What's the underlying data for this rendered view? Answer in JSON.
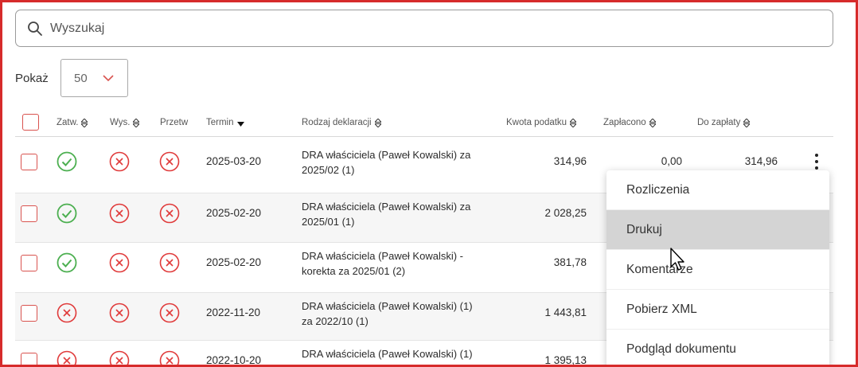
{
  "search": {
    "placeholder": "Wyszukaj"
  },
  "show": {
    "label": "Pokaż",
    "value": "50"
  },
  "headers": {
    "approved": "Zatw.",
    "sent": "Wys.",
    "processed": "Przetw",
    "deadline": "Termin",
    "declaration": "Rodzaj deklaracji",
    "tax_amount": "Kwota podatku",
    "paid": "Zapłacono",
    "to_pay": "Do zapłaty"
  },
  "rows": [
    {
      "approved": "check",
      "sent": "x",
      "processed": "x",
      "deadline": "2025-03-20",
      "decl_line1": "DRA właściciela (Paweł Kowalski) za",
      "decl_line2": "2025/02 (1)",
      "tax": "314,96",
      "paid": "0,00",
      "to_pay": "314,96"
    },
    {
      "approved": "check",
      "sent": "x",
      "processed": "x",
      "deadline": "2025-02-20",
      "decl_line1": "DRA właściciela (Paweł Kowalski) za",
      "decl_line2": "2025/01 (1)",
      "tax": "2 028,25"
    },
    {
      "approved": "check",
      "sent": "x",
      "processed": "x",
      "deadline": "2025-02-20",
      "decl_line1": "DRA właściciela (Paweł Kowalski) -",
      "decl_line2": "korekta za 2025/01 (2)",
      "tax": "381,78"
    },
    {
      "approved": "x",
      "sent": "x",
      "processed": "x",
      "deadline": "2022-11-20",
      "decl_line1": "DRA właściciela (Paweł Kowalski) (1)",
      "decl_line2": "za 2022/10 (1)",
      "tax": "1 443,81"
    },
    {
      "approved": "x",
      "sent": "x",
      "processed": "x",
      "deadline": "2022-10-20",
      "decl_line1": "DRA właściciela (Paweł Kowalski) (1)",
      "decl_line2": "",
      "tax": "1 395,13"
    }
  ],
  "menu": {
    "items": [
      "Rozliczenia",
      "Drukuj",
      "Komentarze",
      "Pobierz XML",
      "Podgląd dokumentu"
    ],
    "active": "Drukuj"
  },
  "colors": {
    "accent": "#d62b2b",
    "success": "#4caf50",
    "error": "#e03a3a"
  }
}
